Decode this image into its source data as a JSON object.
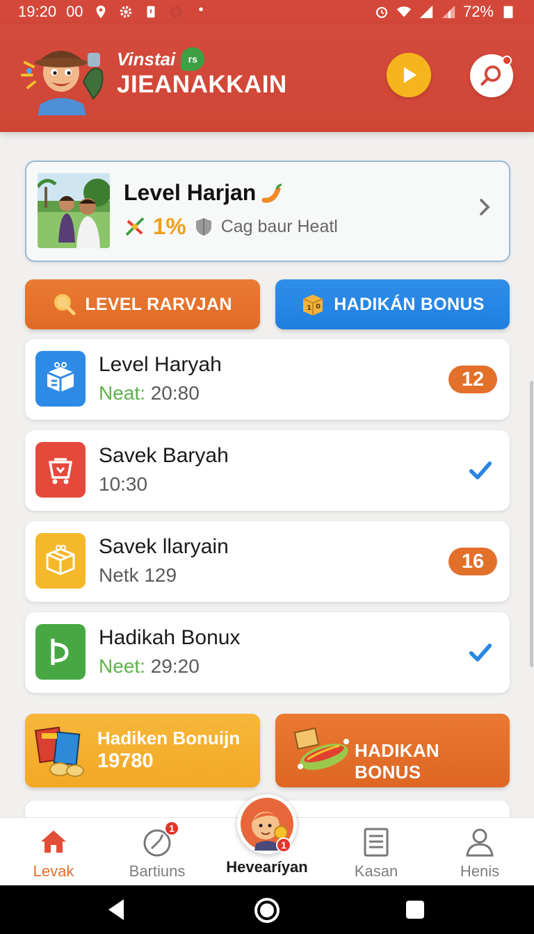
{
  "status_bar": {
    "time": "19:20",
    "extra": "00",
    "battery": "72%"
  },
  "header": {
    "brand_sub": "Vinstai",
    "brand_leaf": "rs",
    "brand_title": "JIEANAKKAIN",
    "play_icon": "play-icon",
    "search_icon": "search-icon"
  },
  "level_card": {
    "title": "Level Harjan",
    "percent": "1%",
    "caption": "Cag baur Heatl"
  },
  "actions": {
    "left_label": "LEVEL RARVJAN",
    "right_label": "HADIKÁN BONUS"
  },
  "list": [
    {
      "title": "Level Haryah",
      "sub_prefix": "Neat:",
      "sub": "20:80",
      "badge": "12",
      "icon_color": "#2d8be6"
    },
    {
      "title": "Savek Baryah",
      "sub_prefix": "",
      "sub": "10:30",
      "checked": true,
      "icon_color": "#e5493b"
    },
    {
      "title": "Savek llaryain",
      "sub_prefix": "",
      "sub": "Netk 129",
      "badge": "16",
      "icon_color": "#f5b82b"
    },
    {
      "title": "Hadikah Bonux",
      "sub_prefix": "Neet:",
      "sub": "29:20",
      "checked": true,
      "icon_color": "#47a843"
    }
  ],
  "promos": {
    "left_line1": "Hadiken Bonuijn",
    "left_line2": "19780",
    "right_label": "HADIKAN BONUS"
  },
  "bottom_nav": [
    {
      "label": "Levak",
      "icon": "home-icon",
      "active": true
    },
    {
      "label": "Bartiuns",
      "icon": "compass-icon",
      "badge": "1"
    },
    {
      "label": "Hevearíyan",
      "icon": "avatar-icon",
      "badge": "1"
    },
    {
      "label": "Kasan",
      "icon": "document-icon"
    },
    {
      "label": "Henis",
      "icon": "person-icon"
    }
  ],
  "colors": {
    "header": "#d3483a",
    "accent_orange": "#e2702a",
    "accent_blue": "#2f8ee9",
    "accent_yellow": "#f6b51d",
    "green": "#5db24b"
  }
}
